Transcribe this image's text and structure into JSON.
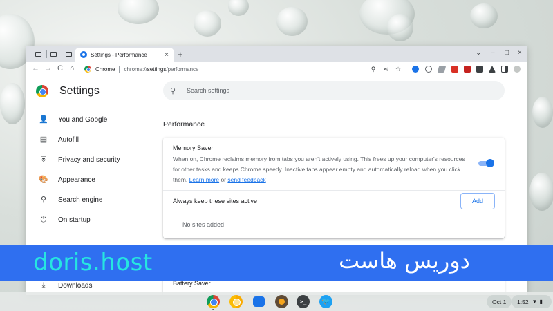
{
  "window": {
    "active_tab_title": "Settings - Performance",
    "tab_close": "×",
    "new_tab": "+",
    "controls": [
      "⌄",
      "–",
      "□",
      "×"
    ]
  },
  "toolbar": {
    "back": "←",
    "forward": "→",
    "reload": "C",
    "home": "⌂",
    "site_name": "Chrome",
    "url_scheme": "chrome://",
    "url_host": "settings",
    "url_path": "/performance",
    "icons": {
      "zoom": "⚲",
      "share": "⋖",
      "star": "☆",
      "menu": "⋮"
    }
  },
  "sidebar": {
    "title": "Settings",
    "items": [
      {
        "label": "You and Google",
        "icon": "person-icon"
      },
      {
        "label": "Autofill",
        "icon": "clipboard-icon"
      },
      {
        "label": "Privacy and security",
        "icon": "shield-icon"
      },
      {
        "label": "Appearance",
        "icon": "palette-icon"
      },
      {
        "label": "Search engine",
        "icon": "search-icon"
      },
      {
        "label": "On startup",
        "icon": "power-icon"
      },
      {
        "label": "Downloads",
        "icon": "download-icon"
      }
    ]
  },
  "search": {
    "placeholder": "Search settings"
  },
  "performance": {
    "heading": "Performance",
    "memory_saver": {
      "title": "Memory Saver",
      "desc_prefix": "When on, Chrome reclaims memory from tabs you aren't actively using. This frees up your computer's resources for other tasks and keeps Chrome speedy. Inactive tabs appear empty and automatically reload when you click them. ",
      "learn_more": "Learn more",
      "or": " or ",
      "send_feedback": "send feedback",
      "enabled": true
    },
    "always_active_label": "Always keep these sites active",
    "add_button": "Add",
    "no_sites": "No sites added",
    "battery_saver": "Battery Saver"
  },
  "banner": {
    "latin": "doris.host",
    "arabic": "دوريس هاست"
  },
  "shelf": {
    "date": "Oct 1",
    "time": "1:52",
    "apps": [
      "chrome-icon",
      "chrome-canary-icon",
      "files-icon",
      "notes-icon",
      "terminal-icon",
      "twitter-icon"
    ],
    "terminal_glyph": ">_",
    "twitter_glyph": "🐦"
  },
  "colors": {
    "accent": "#1a73e8",
    "banner_bg": "#2f6ff0",
    "banner_text": "#26e6e0"
  }
}
